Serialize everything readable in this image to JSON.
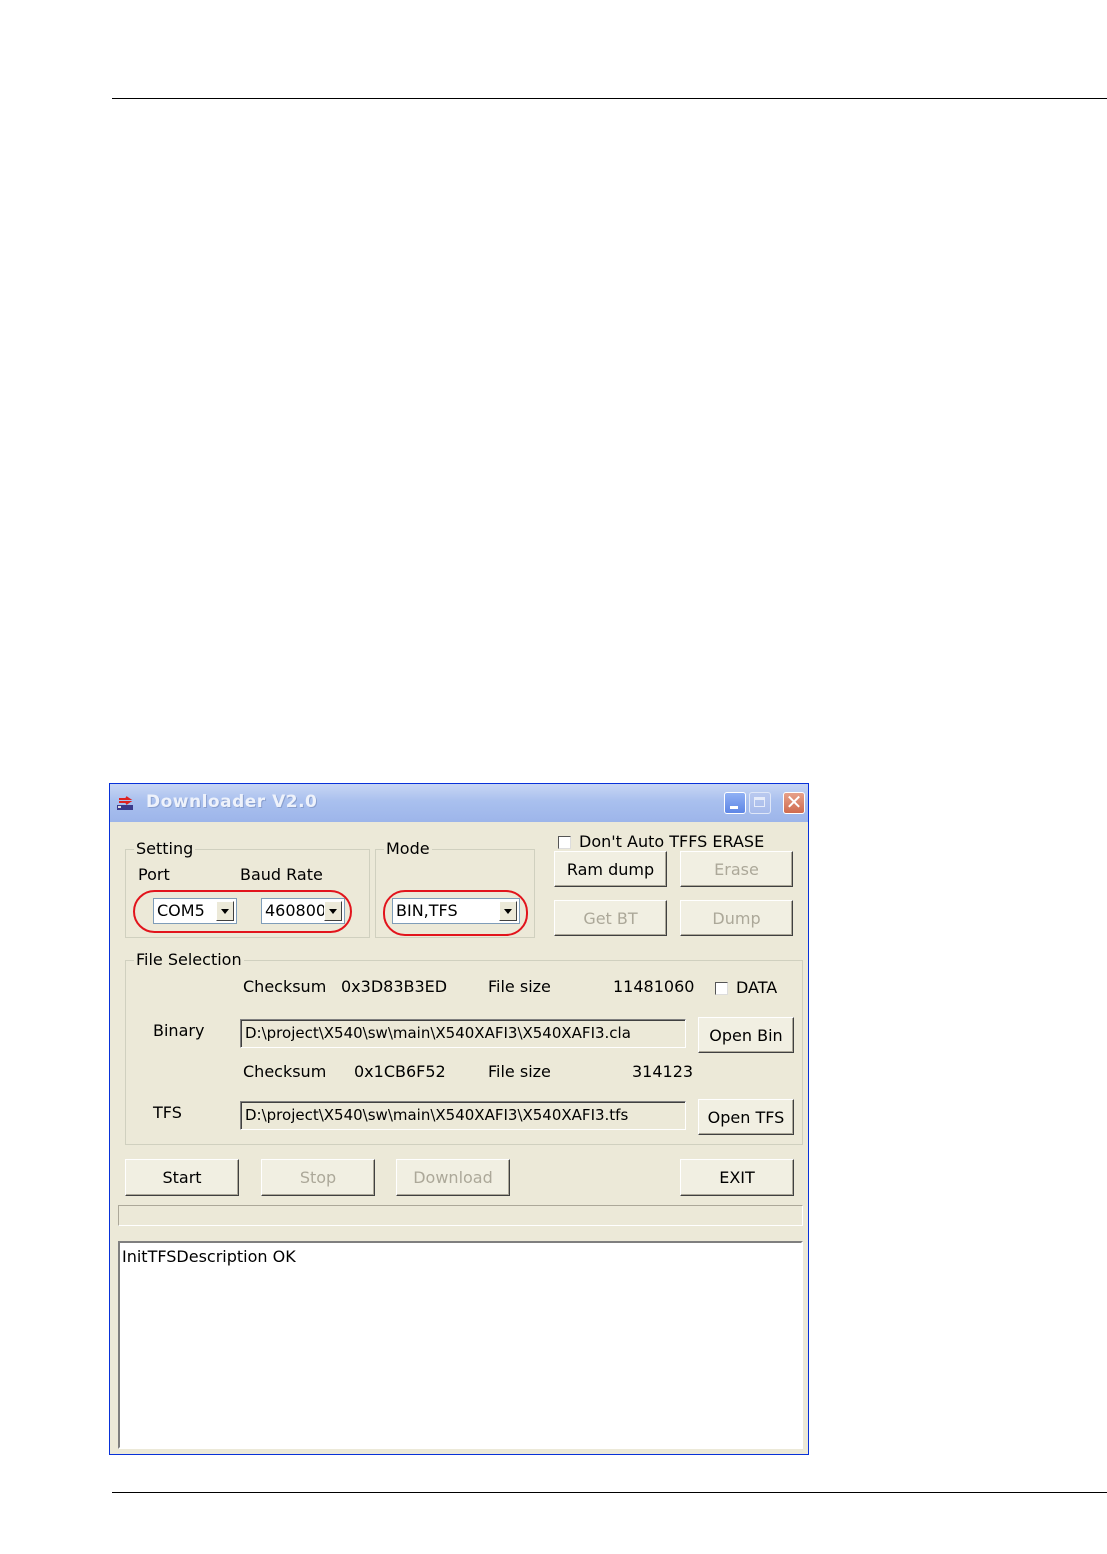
{
  "window": {
    "title": "Downloader V2.0",
    "close_glyph": "✕"
  },
  "setting": {
    "legend": "Setting",
    "port_label": "Port",
    "baud_label": "Baud Rate",
    "port_value": "COM5",
    "baud_value": "460800"
  },
  "mode": {
    "legend": "Mode",
    "value": "BIN,TFS"
  },
  "options": {
    "dont_auto_tffs_erase_label": "Don't Auto TFFS ERASE",
    "dont_auto_tffs_erase_checked": false
  },
  "buttons": {
    "ram_dump": "Ram dump",
    "erase": "Erase",
    "get_bt": "Get BT",
    "dump": "Dump",
    "open_bin": "Open Bin",
    "open_tfs": "Open TFS",
    "start": "Start",
    "stop": "Stop",
    "download": "Download",
    "exit": "EXIT"
  },
  "file_selection": {
    "legend": "File Selection",
    "binary": {
      "label": "Binary",
      "checksum_label": "Checksum",
      "checksum": "0x3D83B3ED",
      "filesize_label": "File size",
      "filesize": "11481060",
      "path": "D:\\project\\X540\\sw\\main\\X540XAFI3\\X540XAFI3.cla"
    },
    "data_checkbox_label": "DATA",
    "data_checked": false,
    "tfs": {
      "label": "TFS",
      "checksum_label": "Checksum",
      "checksum": "0x1CB6F52",
      "filesize_label": "File size",
      "filesize": "314123",
      "path": "D:\\project\\X540\\sw\\main\\X540XAFI3\\X540XAFI3.tfs"
    }
  },
  "log": {
    "lines": [
      "InitTFSDescription OK"
    ]
  },
  "colors": {
    "highlight_ring": "#e2141c",
    "window_face": "#ece9d8",
    "titlebar": "#a9c0ee"
  }
}
